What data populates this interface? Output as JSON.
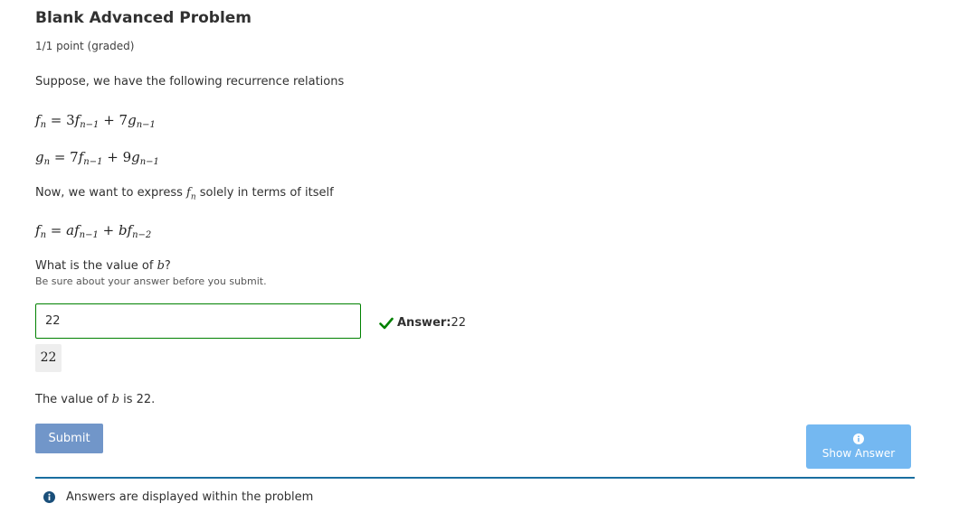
{
  "problem": {
    "title": "Blank Advanced Problem",
    "points": "1/1 point (graded)",
    "intro": "Suppose, we have the following recurrence relations",
    "eq1": {
      "lhs": "f",
      "lhs_sub": "n",
      "eq": " = 3",
      "t1": "f",
      "t1_sub": "n−1",
      "plus": " + 7",
      "t2": "g",
      "t2_sub": "n−1"
    },
    "eq2": {
      "lhs": "g",
      "lhs_sub": "n",
      "eq": " = 7",
      "t1": "f",
      "t1_sub": "n−1",
      "plus": " + 9",
      "t2": "g",
      "t2_sub": "n−1"
    },
    "express_pre": "Now, we want to express ",
    "express_var": "f",
    "express_sub": "n",
    "express_post": " solely in terms of itself",
    "eq3": {
      "lhs": "f",
      "lhs_sub": "n",
      "eq": " = ",
      "a": "a",
      "t1": "f",
      "t1_sub": "n−1",
      "plus": " + ",
      "b": "b",
      "t2": "f",
      "t2_sub": "n−2"
    },
    "question_pre": "What is the value of ",
    "question_var": "b",
    "question_post": "?",
    "hint": "Be sure about your answer before you submit."
  },
  "answer": {
    "input_value": "22",
    "status_label": "Answer:",
    "status_value": " 22",
    "preview": "22",
    "explanation_pre": "The value of ",
    "explanation_var": "b",
    "explanation_post": " is 22."
  },
  "actions": {
    "submit_label": "Submit",
    "show_answer_label": "Show Answer"
  },
  "notification": {
    "text": "Answers are displayed within the problem"
  },
  "colors": {
    "correct": "#008100",
    "submit_bg": "#7196c9",
    "show_answer_bg": "#74b8f1",
    "divider": "#1a6ea0"
  },
  "icons": {
    "status": "checkmark-icon",
    "show_answer": "info-circle-icon",
    "notification": "info-circle-icon"
  }
}
